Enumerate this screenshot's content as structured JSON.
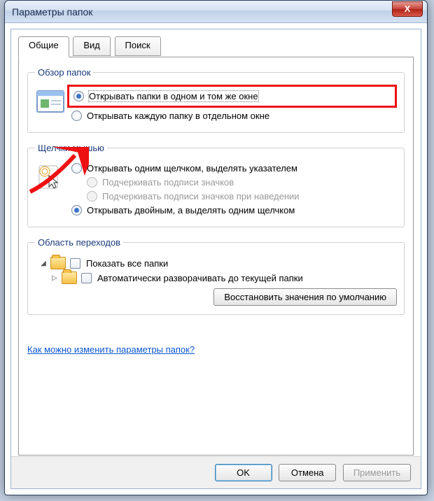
{
  "window": {
    "title": "Параметры папок",
    "close_glyph": "X"
  },
  "tabs": [
    {
      "label": "Общие",
      "active": true
    },
    {
      "label": "Вид",
      "active": false
    },
    {
      "label": "Поиск",
      "active": false
    }
  ],
  "groups": {
    "browse": {
      "legend": "Обзор папок",
      "options": [
        {
          "label": "Открывать папки в одном и том же окне",
          "checked": true,
          "highlighted": true
        },
        {
          "label": "Открывать каждую папку в отдельном окне",
          "checked": false
        }
      ]
    },
    "click": {
      "legend": "Щелчки мышью",
      "options": [
        {
          "label": "Открывать одним щелчком, выделять указателем",
          "checked": false,
          "disabled": false
        },
        {
          "label": "Подчеркивать подписи значков",
          "checked": false,
          "disabled": true,
          "indent": true
        },
        {
          "label": "Подчеркивать подписи значков при наведении",
          "checked": false,
          "disabled": true,
          "indent": true
        },
        {
          "label": "Открывать двойным, а выделять одним щелчком",
          "checked": true,
          "disabled": false
        }
      ]
    },
    "nav": {
      "legend": "Область переходов",
      "items": [
        {
          "label": "Показать все папки",
          "checked": false
        },
        {
          "label": "Автоматически разворачивать до текущей папки",
          "checked": false
        }
      ]
    }
  },
  "restore_defaults": "Восстановить значения по умолчанию",
  "help_link": "Как можно изменить параметры папок?",
  "buttons": {
    "ok": "OK",
    "cancel": "Отмена",
    "apply": "Применить"
  }
}
